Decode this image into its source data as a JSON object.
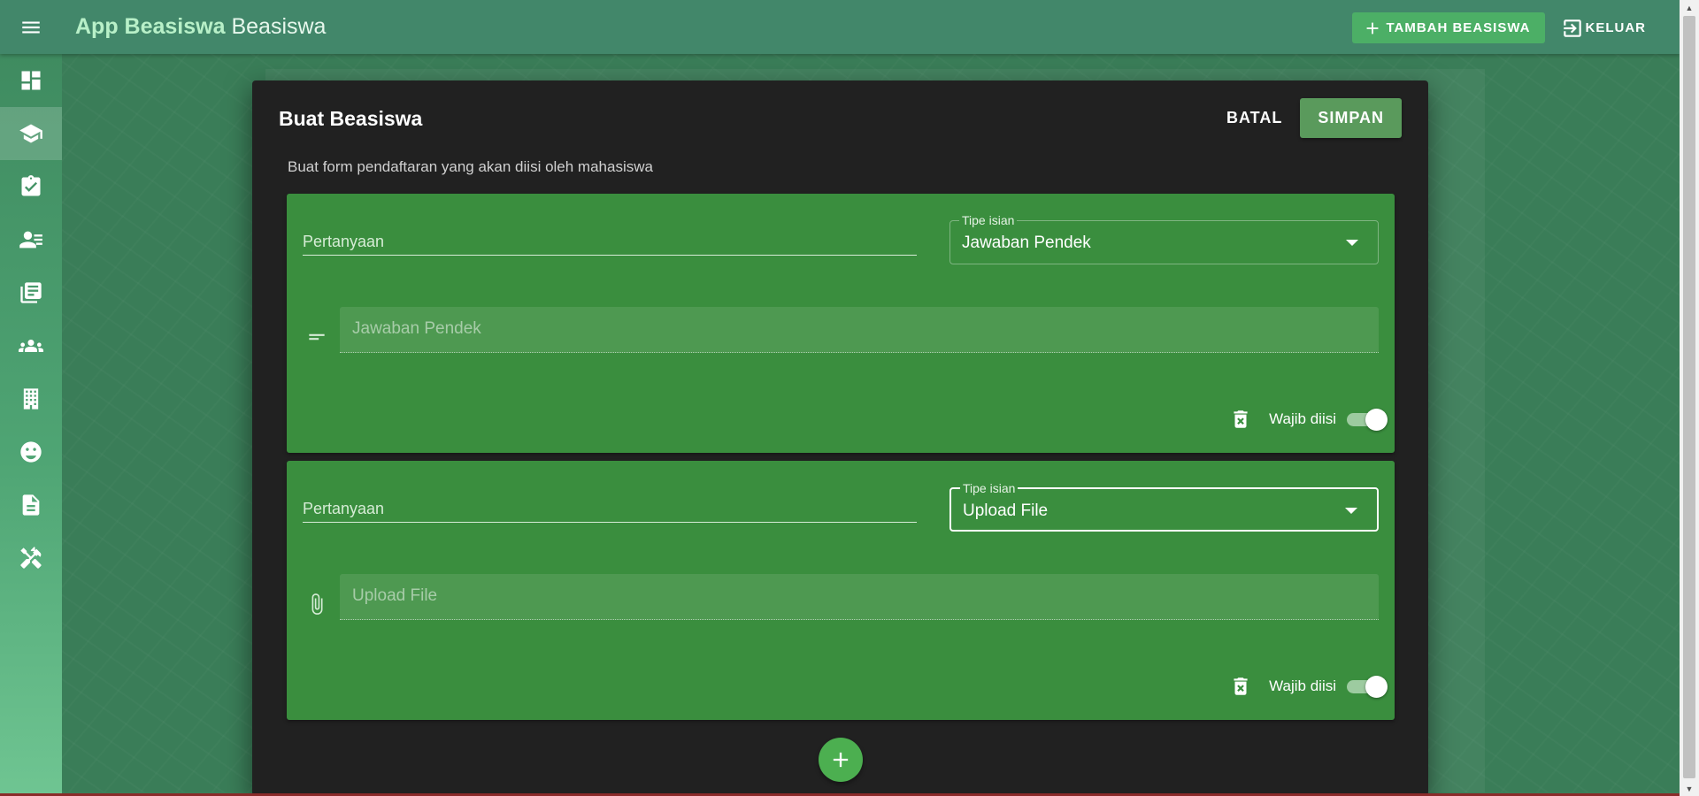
{
  "header": {
    "app_title_bold": "App Beasiswa",
    "app_title_light": "Beasiswa",
    "add_button_label": "TAMBAH BEASISWA",
    "logout_label": "KELUAR"
  },
  "sidebar": {
    "items": [
      {
        "icon": "dashboard-icon"
      },
      {
        "icon": "scholarship-icon",
        "active": true
      },
      {
        "icon": "assignment-check-icon"
      },
      {
        "icon": "contact-list-icon"
      },
      {
        "icon": "library-books-icon"
      },
      {
        "icon": "people-icon"
      },
      {
        "icon": "building-icon"
      },
      {
        "icon": "face-icon"
      },
      {
        "icon": "document-icon"
      },
      {
        "icon": "tools-icon"
      }
    ]
  },
  "dialog": {
    "title": "Buat Beasiswa",
    "cancel_label": "BATAL",
    "save_label": "SIMPAN",
    "subtitle": "Buat form pendaftaran yang akan diisi oleh mahasiswa",
    "questions": [
      {
        "question_placeholder": "Pertanyaan",
        "type_label": "Tipe isian",
        "type_value": "Jawaban Pendek",
        "answer_placeholder": "Jawaban Pendek",
        "answer_icon": "short-text-icon",
        "required_label": "Wajib diisi",
        "required": true
      },
      {
        "question_placeholder": "Pertanyaan",
        "type_label": "Tipe isian",
        "type_value": "Upload File",
        "answer_placeholder": "Upload File",
        "answer_icon": "attachment-icon",
        "required_label": "Wajib diisi",
        "required": true
      }
    ]
  },
  "colors": {
    "topbar": "#42876a",
    "dialog_bg": "#212121",
    "card_bg": "#3a8e3e",
    "accent": "#4caf50"
  }
}
